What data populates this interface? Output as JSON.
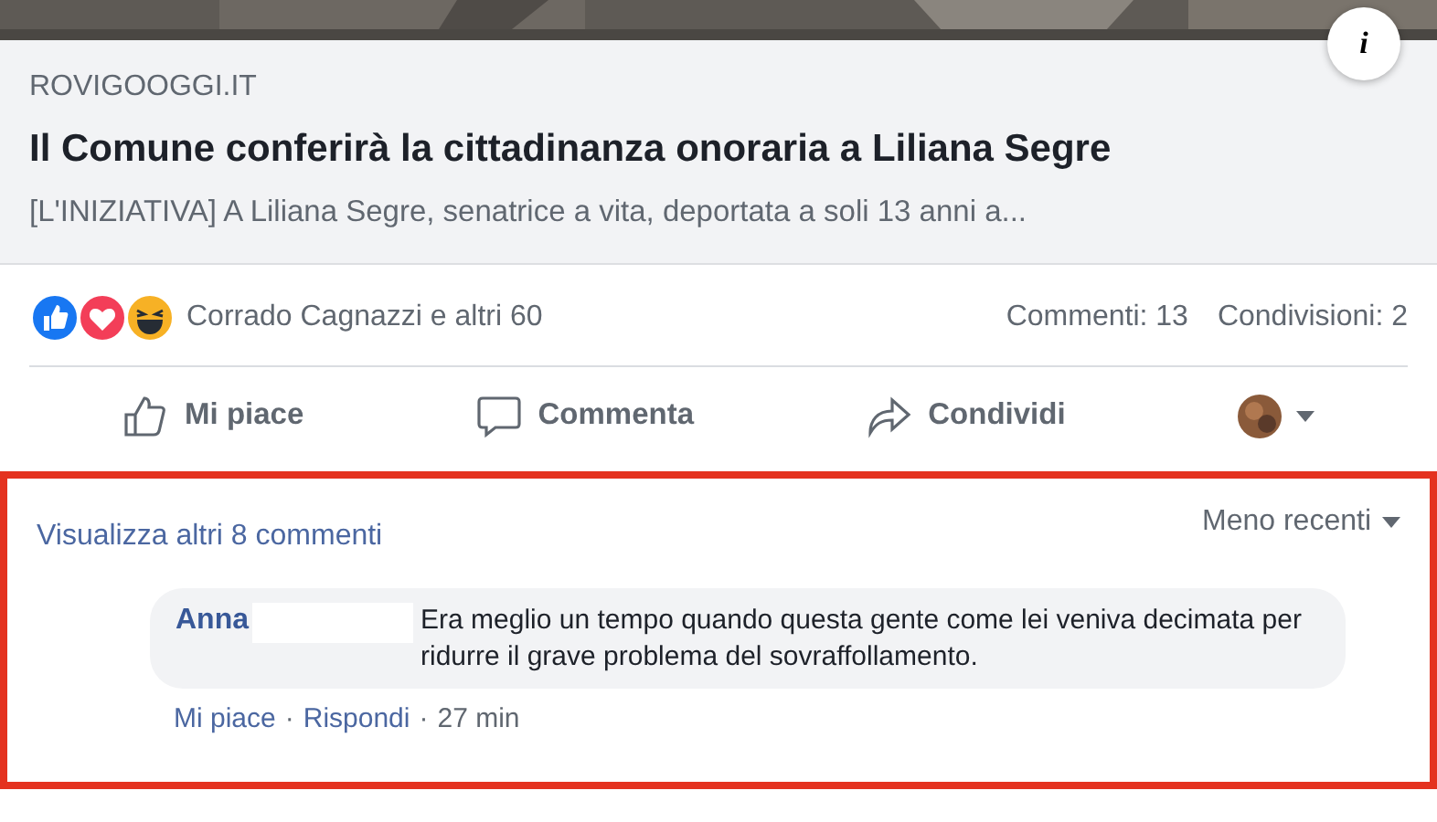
{
  "link_preview": {
    "info_button": "i",
    "domain": "ROVIGOOGGI.IT",
    "title": "Il Comune conferirà la cittadinanza onoraria a Liliana Segre",
    "description": "[L'INIZIATIVA] A Liliana Segre, senatrice a vita, deportata a soli 13 anni a..."
  },
  "reactions": {
    "icons": [
      {
        "kind": "like"
      },
      {
        "kind": "love"
      },
      {
        "kind": "haha"
      }
    ],
    "summary": "Corrado Cagnazzi e altri 60",
    "comments_count": "Commenti: 13",
    "shares_count": "Condivisioni: 2"
  },
  "actions": [
    {
      "kind": "like",
      "label": "Mi piace"
    },
    {
      "kind": "comment",
      "label": "Commenta"
    },
    {
      "kind": "share",
      "label": "Condividi"
    }
  ],
  "comments": {
    "highlighted": true,
    "more_link": "Visualizza altri 8 commenti",
    "sort": "Meno recenti",
    "items": [
      {
        "author": "Anna",
        "redacted": true,
        "text": "Era meglio un tempo quando questa gente come lei veniva decimata per ridurre il grave problema del sovraffollamento.",
        "footer": [
          {
            "kind": "link",
            "text": "Mi piace"
          },
          {
            "kind": "sep",
            "text": "·"
          },
          {
            "kind": "link",
            "text": "Rispondi"
          },
          {
            "kind": "sep",
            "text": "·"
          },
          {
            "kind": "time",
            "text": "27 min"
          }
        ]
      }
    ]
  }
}
